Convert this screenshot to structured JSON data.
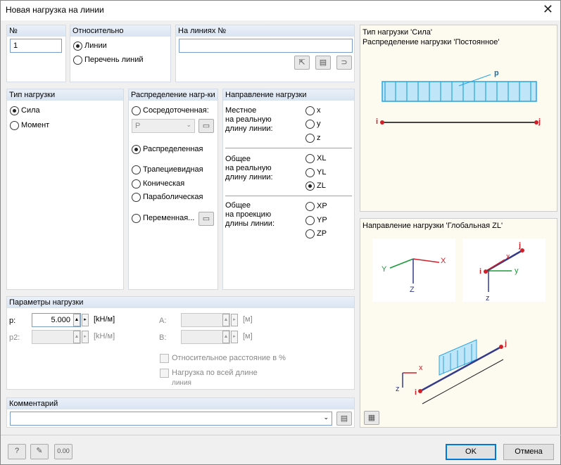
{
  "window": {
    "title": "Новая нагрузка на линии"
  },
  "no": {
    "label": "№",
    "value": "1"
  },
  "relative": {
    "label": "Относительно",
    "opt_lines": "Линии",
    "opt_list": "Перечень линий"
  },
  "on_lines": {
    "label": "На линиях №",
    "value": ""
  },
  "load_type": {
    "label": "Тип нагрузки",
    "opt_force": "Сила",
    "opt_moment": "Момент"
  },
  "distribution": {
    "label": "Распределение нагр-ки",
    "opt_concentrated": "Сосредоточенная:",
    "concentrated_value": "P",
    "opt_uniform": "Распределенная",
    "opt_trapezoid": "Трапециевидная",
    "opt_tapered": "Коническая",
    "opt_parabolic": "Параболическая",
    "opt_varying": "Переменная..."
  },
  "direction": {
    "label": "Направление нагрузки",
    "local_label": "Местное\nна реальную\nдлину линии:",
    "global_true_label": "Общее\nна реальную\nдлину линии:",
    "global_proj_label": "Общее\nна проекцию\nдлины линии:",
    "x": "x",
    "y": "y",
    "z": "z",
    "xl": "XL",
    "yl": "YL",
    "zl": "ZL",
    "xp": "XP",
    "yp": "YP",
    "zp": "ZP"
  },
  "params": {
    "label": "Параметры нагрузки",
    "p_label": "p:",
    "p_value": "5.000",
    "p_unit": "[kH/м]",
    "p2_label": "p2:",
    "p2_unit": "[kH/м]",
    "a_label": "A:",
    "a_unit": "[м]",
    "b_label": "B:",
    "b_unit": "[м]",
    "rel_dist": "Относительное расстояние в %",
    "full_len": "Нагрузка по всей длине",
    "full_len_sub": "линия"
  },
  "comment": {
    "label": "Комментарий",
    "value": ""
  },
  "preview_top": {
    "line1": "Тип нагрузки 'Сила'",
    "line2": "Распределение нагрузки 'Постоянное'",
    "p_tag": "p",
    "i_tag": "i",
    "j_tag": "j"
  },
  "preview_bottom": {
    "title": "Направление нагрузки 'Глобальная ZL'",
    "ax_x": "X",
    "ax_y": "Y",
    "ax_z": "Z",
    "ax_x_s": "x",
    "ax_y_s": "y",
    "ax_z_s": "z",
    "i_tag": "i",
    "j_tag": "j"
  },
  "buttons": {
    "ok": "OK",
    "cancel": "Отмена"
  },
  "colors": {
    "accent": "#0078d7",
    "load_blue": "#29a3e0",
    "node_red": "#d0202a"
  }
}
